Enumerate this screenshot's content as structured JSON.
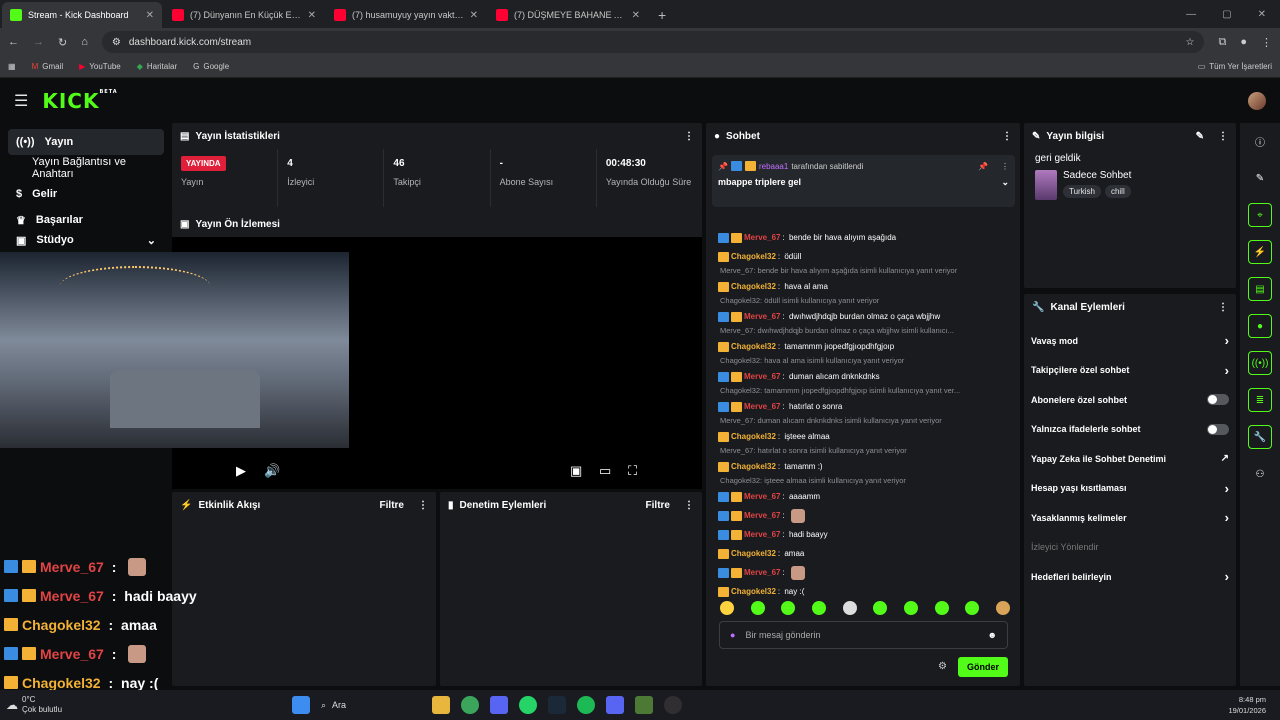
{
  "browser": {
    "tabs": [
      {
        "title": "Stream - Kick Dashboard",
        "color": "#53fc18"
      },
      {
        "title": "(7) Dünyanın En Küçük Evleri: T...",
        "color": "#ff0033"
      },
      {
        "title": "(7) husamuyuy yayın vakti 14 -",
        "color": "#ff0033"
      },
      {
        "title": "(7) DÜŞMEYE BAHANE ARAMA...",
        "color": "#ff0033"
      }
    ],
    "close": "✕",
    "newtab": "+",
    "url": "dashboard.kick.com/stream",
    "bookmarks": [
      "Gmail",
      "YouTube",
      "Haritalar",
      "Google"
    ],
    "all_bookmarks": "Tüm Yer İşaretleri"
  },
  "header": {
    "logo": "KICK",
    "beta": "BETA"
  },
  "sidebar": {
    "items": [
      "Yayın",
      "Yayın Bağlantısı ve Anahtarı",
      "Gelir",
      "Başarılar",
      "Stüdyo"
    ]
  },
  "stats": {
    "title": "Yayın İstatistikleri",
    "live_badge": "YAYINDA",
    "items": [
      {
        "value": "4",
        "label": "İzleyici"
      },
      {
        "value": "46",
        "label": "Takipçi"
      },
      {
        "value": "-",
        "label": "Abone Sayısı"
      },
      {
        "value": "00:48:30",
        "label": "Yayında Olduğu Süre"
      }
    ],
    "first_label": "Yayın"
  },
  "preview": {
    "title": "Yayın Ön İzlemesi"
  },
  "feed": {
    "title": "Etkinlik Akışı",
    "filter": "Filtre"
  },
  "moderation": {
    "title": "Denetim Eylemleri",
    "filter": "Filtre"
  },
  "chat": {
    "title": "Sohbet",
    "pinned_by": "rebaaa1",
    "pinned_suffix": " tarafından sabitlendi",
    "pinned_message": "mbappe triplere gel",
    "messages": [
      {
        "user": "Merve_67",
        "text": "bende bir hava alıyım aşağıda",
        "type": "v"
      },
      {
        "user": "Chagokel32",
        "text": "ödüll",
        "type": "c"
      },
      {
        "reply": "Merve_67: bende bir hava alıyım aşağıda isimli kullanıcıya yanıt veriyor",
        "user": "Chagokel32",
        "text": "hava al ama",
        "type": "c"
      },
      {
        "reply": "Chagokel32: ödüll isimli kullanıcıya yanıt veriyor",
        "user": "Merve_67",
        "text": "dwıhwdjhdqjb burdan olmaz o çaça wbjjhw",
        "type": "v"
      },
      {
        "reply": "Merve_67: dwıhwdjhdqjb burdan olmaz o çaça wbjjhw isimli kullanıcı...",
        "user": "Chagokel32",
        "text": "tamammm jıopedfgjıopdhfgjoıp",
        "type": "c"
      },
      {
        "reply": "Chagokel32: hava al ama isimli kullanıcıya yanıt veriyor",
        "user": "Merve_67",
        "text": "duman alıcam dnknkdnks",
        "type": "v"
      },
      {
        "reply": "Chagokel32: tamammm jıopedfgjıopdhfgjoıp isimli kullanıcıya yanıt ver...",
        "user": "Merve_67",
        "text": "hatırlat o sonra",
        "type": "v"
      },
      {
        "reply": "Merve_67: duman alıcam dnknkdnks isimli kullanıcıya yanıt veriyor",
        "user": "Chagokel32",
        "text": "işteee almaa",
        "type": "c"
      },
      {
        "reply": "Merve_67: hatırlat o sonra isimli kullanıcıya yanıt veriyor",
        "user": "Chagokel32",
        "text": "tamamm :)",
        "type": "c"
      },
      {
        "reply": "Chagokel32: işteee almaa isimli kullanıcıya yanıt veriyor",
        "user": "Merve_67",
        "text": "aaaamm",
        "type": "v"
      },
      {
        "user": "Merve_67",
        "text": "",
        "type": "v"
      },
      {
        "user": "Merve_67",
        "text": "hadi baayy",
        "type": "v"
      },
      {
        "user": "Chagokel32",
        "text": "amaa",
        "type": "c"
      },
      {
        "user": "Merve_67",
        "text": "",
        "type": "v"
      },
      {
        "user": "Chagokel32",
        "text": "nay :(",
        "type": "c"
      }
    ],
    "input_placeholder": "Bir mesaj gönderin",
    "send": "Gönder"
  },
  "stream_info": {
    "title": "Yayın bilgisi",
    "stream_title": "geri geldik",
    "category": "Sadece Sohbet",
    "tags": [
      "Turkish",
      "chill"
    ]
  },
  "channel_actions": {
    "title": "Kanal Eylemleri",
    "items": [
      {
        "label": "Vavaş mod",
        "ctl": "arrow"
      },
      {
        "label": "Takipçilere özel sohbet",
        "ctl": "arrow"
      },
      {
        "label": "Abonelere özel sohbet",
        "ctl": "toggle"
      },
      {
        "label": "Yalnızca ifadelerle sohbet",
        "ctl": "toggle"
      },
      {
        "label": "Yapay Zeka ile Sohbet Denetimi",
        "ctl": "ext"
      },
      {
        "label": "Hesap yaşı kısıtlaması",
        "ctl": "arrow"
      },
      {
        "label": "Yasaklanmış kelimeler",
        "ctl": "arrow"
      },
      {
        "label": "İzleyici Yönlendir",
        "ctl": "none"
      },
      {
        "label": "Hedefleri belirleyin",
        "ctl": "arrow"
      }
    ]
  },
  "overlay": [
    {
      "user": "Merve_67",
      "text": "",
      "type": "v"
    },
    {
      "user": "Merve_67",
      "text": "hadi baayy",
      "type": "v"
    },
    {
      "user": "Chagokel32",
      "text": "amaa",
      "type": "c"
    },
    {
      "user": "Merve_67",
      "text": "",
      "type": "v"
    },
    {
      "user": "Chagokel32",
      "text": "nay :(",
      "type": "c"
    }
  ],
  "taskbar": {
    "weather_temp": "0°C",
    "weather_text": "Çok bulutlu",
    "search": "Ara",
    "time": "8:48 pm",
    "date": "19/01/2026"
  }
}
